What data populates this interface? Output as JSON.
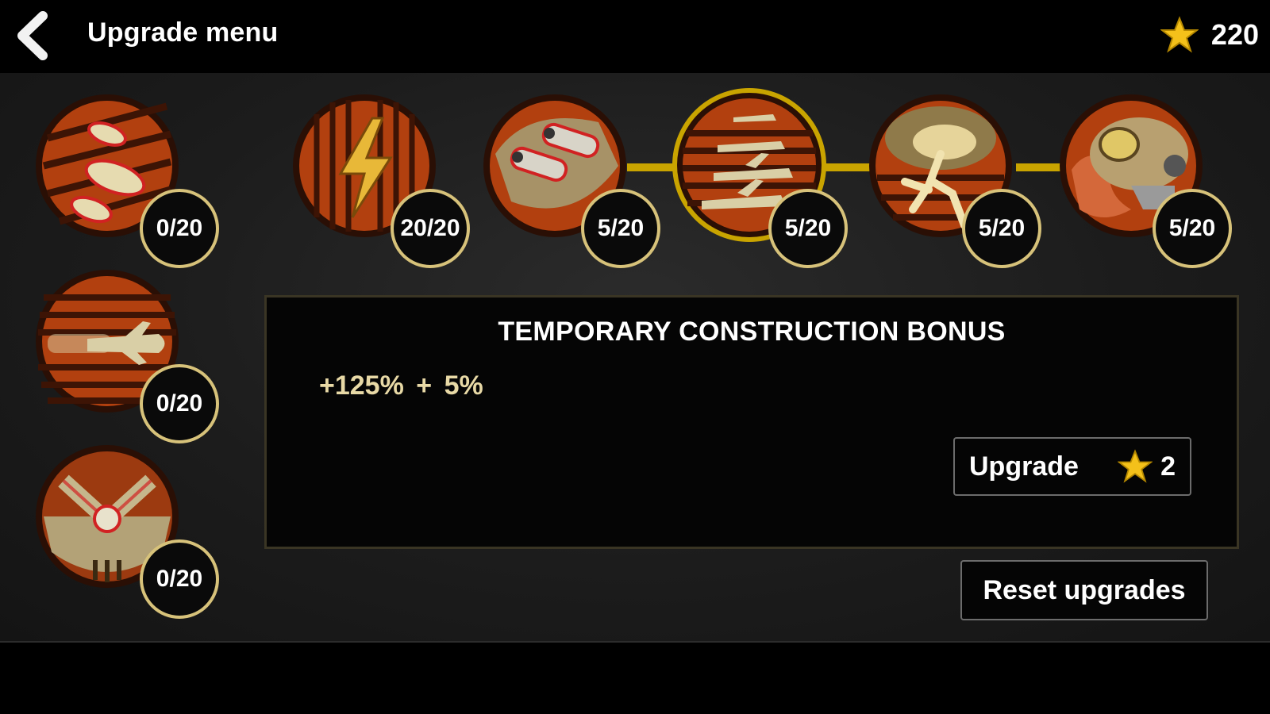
{
  "header": {
    "title": "Upgrade menu",
    "back_icon": "chevron-left-icon",
    "currency_icon": "star-icon",
    "currency_value": "220"
  },
  "upgrades": {
    "left_column": [
      {
        "icon": "bullets-icon",
        "level": "0/20"
      },
      {
        "icon": "speed-plane-icon",
        "level": "0/20"
      },
      {
        "icon": "wrench-icon",
        "level": "0/20"
      }
    ],
    "top_row": [
      {
        "icon": "lightning-icon",
        "level": "20/20"
      },
      {
        "icon": "cannon-icon",
        "level": "5/20"
      },
      {
        "icon": "squadron-icon",
        "level": "5/20",
        "selected": true
      },
      {
        "icon": "explosion-icon",
        "level": "5/20"
      },
      {
        "icon": "helmet-icon",
        "level": "5/20"
      }
    ]
  },
  "details": {
    "title": "TEMPORARY CONSTRUCTION BONUS",
    "bonus_text": "+125%  + 5%",
    "upgrade_label": "Upgrade",
    "upgrade_cost": "2"
  },
  "footer": {
    "reset_label": "Reset upgrades"
  },
  "colors": {
    "medal_orange": "#b2400f",
    "medal_dark": "#4a1a07",
    "accent_gold": "#c9a400",
    "badge_ring": "#d7c27a",
    "star": "#f4c11a"
  }
}
